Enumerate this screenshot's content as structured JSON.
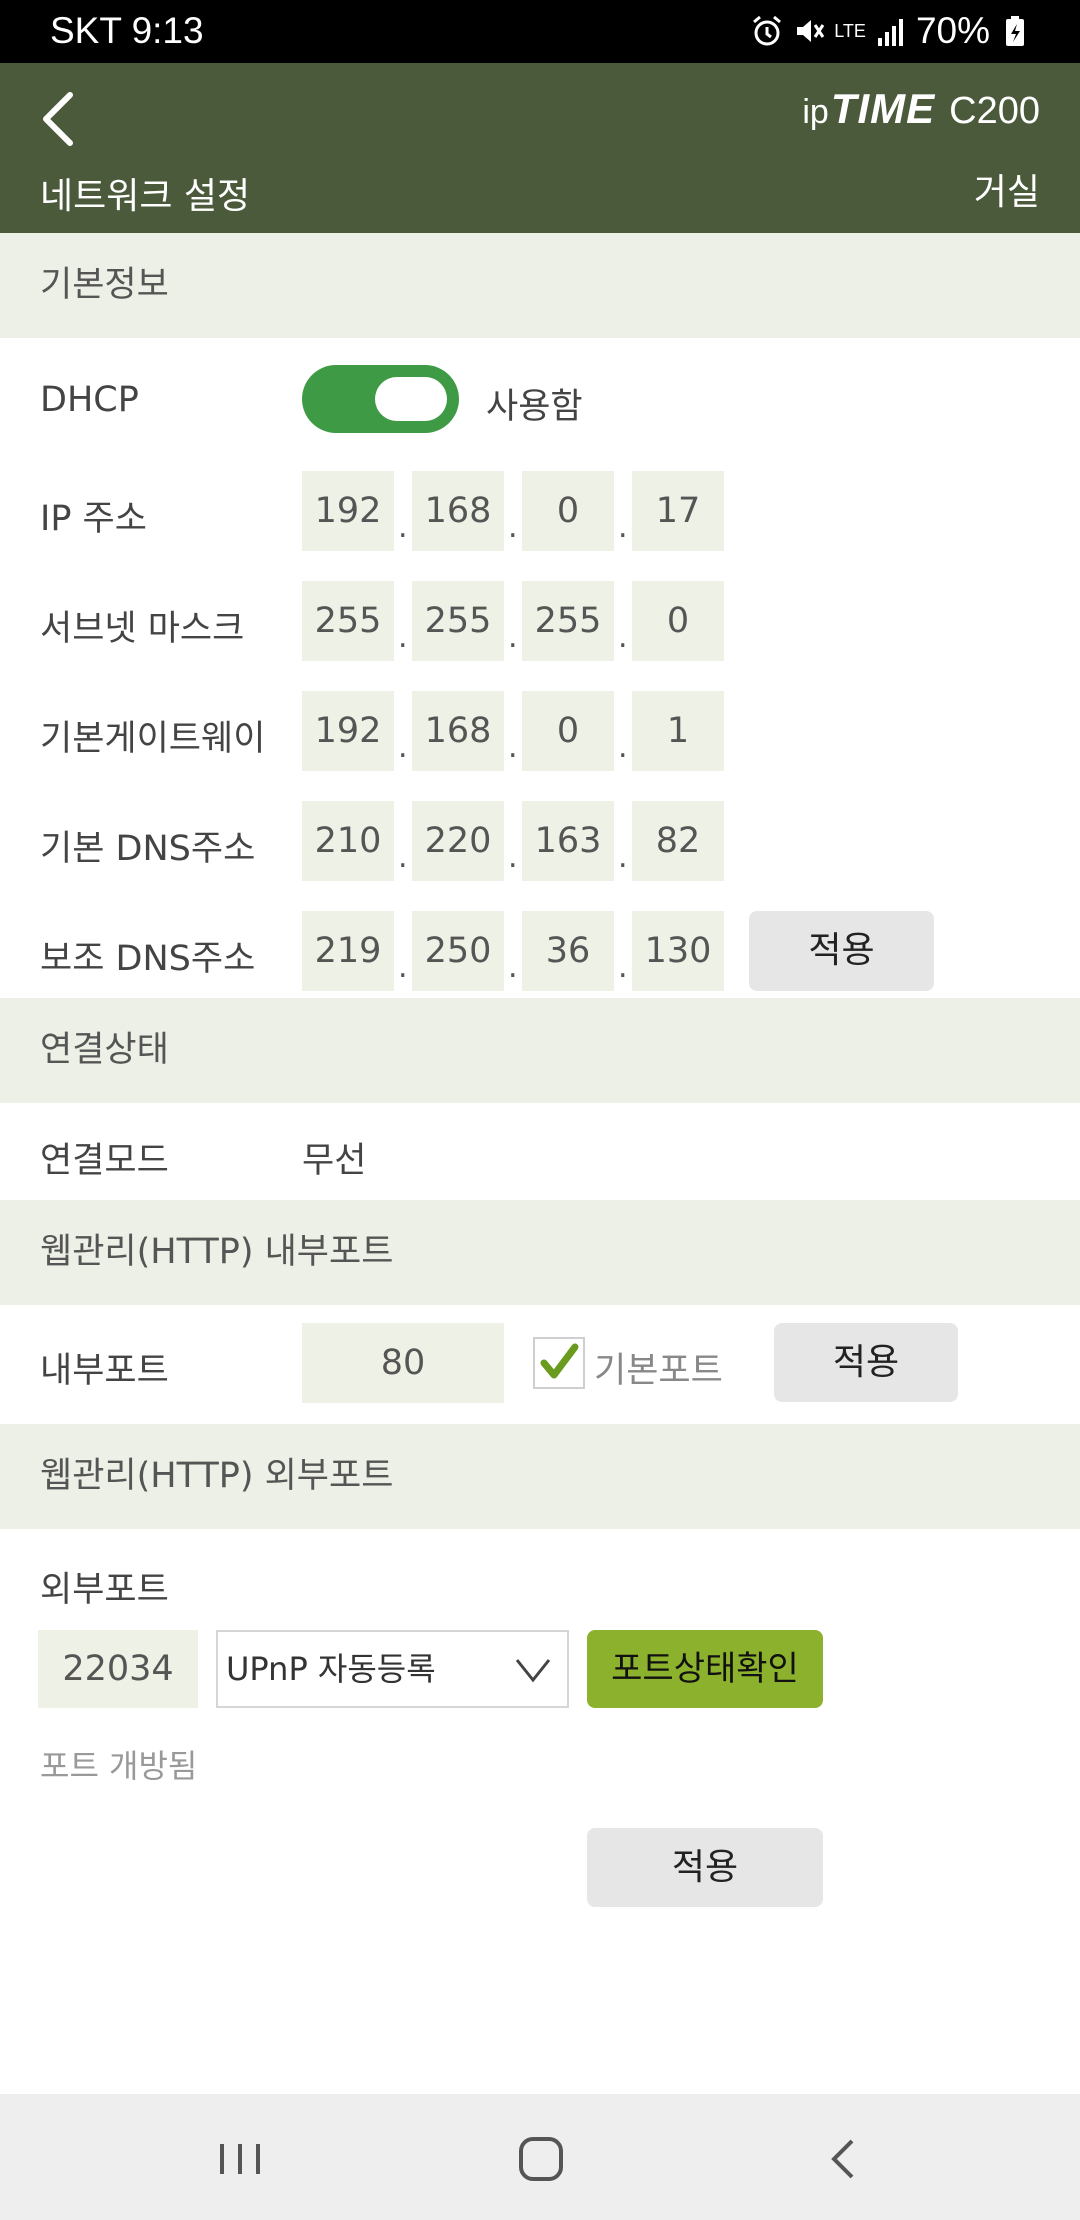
{
  "status_bar": {
    "carrier_time": "SKT 9:13",
    "network": "LTE",
    "battery": "70%"
  },
  "header": {
    "brand_ip": "ip",
    "brand_time": "TIME",
    "model": "C200",
    "title": "네트워크 설정",
    "location": "거실"
  },
  "basic": {
    "section_title": "기본정보",
    "dhcp_label": "DHCP",
    "dhcp_state": "사용함",
    "dhcp_on": true,
    "ip_label": "IP 주소",
    "ip": [
      "192",
      "168",
      "0",
      "17"
    ],
    "subnet_label": "서브넷 마스크",
    "subnet": [
      "255",
      "255",
      "255",
      "0"
    ],
    "gateway_label": "기본게이트웨이",
    "gateway": [
      "192",
      "168",
      "0",
      "1"
    ],
    "dns1_label": "기본 DNS주소",
    "dns1": [
      "210",
      "220",
      "163",
      "82"
    ],
    "dns2_label": "보조 DNS주소",
    "dns2": [
      "219",
      "250",
      "36",
      "130"
    ],
    "dot": ".",
    "apply": "적용"
  },
  "connection": {
    "section_title": "연결상태",
    "mode_label": "연결모드",
    "mode_value": "무선"
  },
  "internal": {
    "section_title": "웹관리(HTTP) 내부포트",
    "port_label": "내부포트",
    "port_value": "80",
    "default_port_label": "기본포트",
    "default_port_checked": true,
    "apply": "적용"
  },
  "external": {
    "section_title": "웹관리(HTTP) 외부포트",
    "port_label": "외부포트",
    "port_value": "22034",
    "select_value": "UPnP 자동등록",
    "check_button": "포트상태확인",
    "status_text": "포트 개방됨",
    "apply": "적용"
  },
  "colors": {
    "header_bg": "#4a5a3a",
    "section_bg": "#edf0e6",
    "toggle_on": "#3f9a45",
    "check_button": "#8cb12c"
  }
}
